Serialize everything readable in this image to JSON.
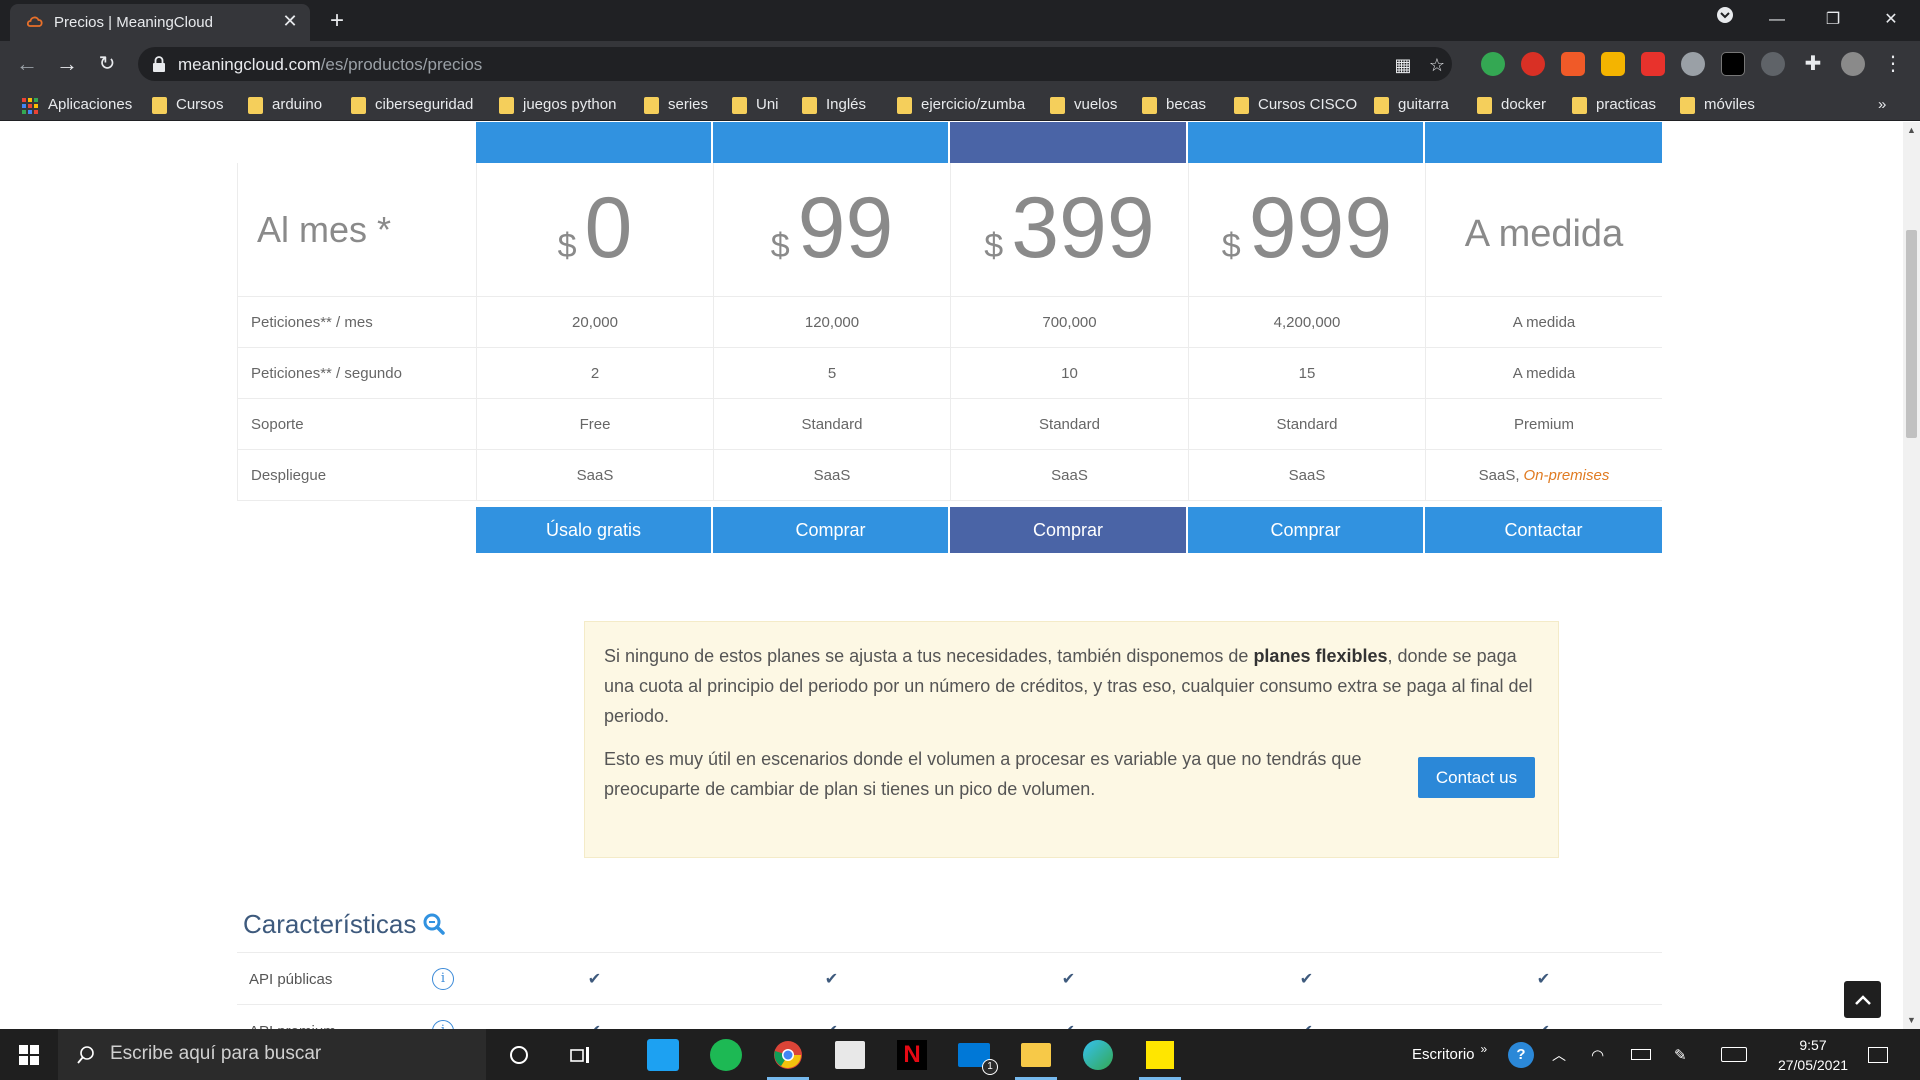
{
  "browser": {
    "tab_title": "Precios | MeaningCloud",
    "url_host": "meaningcloud.com",
    "url_path": "/es/productos/precios",
    "bookmarks": [
      "Aplicaciones",
      "Cursos",
      "arduino",
      "ciberseguridad",
      "juegos python",
      "series",
      "Uni",
      "Inglés",
      "ejercicio/zumba",
      "vuelos",
      "becas",
      "Cursos CISCO",
      "guitarra",
      "docker",
      "practicas",
      "móviles"
    ],
    "more_bookmarks": "»"
  },
  "pricing": {
    "price_label": "Al mes *",
    "currency": "$",
    "plans": [
      {
        "price": "0",
        "requests_month": "20,000",
        "requests_second": "2",
        "support": "Free",
        "deploy": "SaaS",
        "cta": "Úsalo gratis"
      },
      {
        "price": "99",
        "requests_month": "120,000",
        "requests_second": "5",
        "support": "Standard",
        "deploy": "SaaS",
        "cta": "Comprar"
      },
      {
        "price": "399",
        "requests_month": "700,000",
        "requests_second": "10",
        "support": "Standard",
        "deploy": "SaaS",
        "cta": "Comprar"
      },
      {
        "price": "999",
        "requests_month": "4,200,000",
        "requests_second": "15",
        "support": "Standard",
        "deploy": "SaaS",
        "cta": "Comprar"
      },
      {
        "price": "A medida",
        "requests_month": "A medida",
        "requests_second": "A medida",
        "support": "Premium",
        "deploy": "SaaS,",
        "deploy_extra": "On-premises",
        "cta": "Contactar"
      }
    ],
    "rows": {
      "requests_month": "Peticiones** / mes",
      "requests_second": "Peticiones** / segundo",
      "support": "Soporte",
      "deploy": "Despliegue"
    },
    "featured_color": "#4a64a6",
    "accent_color": "#3192e0"
  },
  "flexible": {
    "p1_before": "Si ninguno de estos planes se ajusta a tus necesidades, también disponemos de ",
    "p1_bold": "planes flexibles",
    "p1_after": ", donde se paga una cuota al principio del periodo por un número de créditos, y tras eso, cualquier consumo extra se paga al final del periodo.",
    "p2": "Esto es muy útil en escenarios donde el volumen a procesar es variable ya que no tendrás que preocuparte de cambiar de plan si tienes un pico de volumen.",
    "contact_label": "Contact us"
  },
  "features": {
    "title": "Características",
    "rows": [
      {
        "label": "API públicas",
        "check": "✔"
      },
      {
        "label": "API premium",
        "check": "✔"
      }
    ]
  },
  "taskbar": {
    "search_placeholder": "Escribe aquí para buscar",
    "desktop_label": "Escritorio",
    "chevron": "»",
    "time": "9:57",
    "date": "27/05/2021",
    "mail_badge": "1"
  }
}
